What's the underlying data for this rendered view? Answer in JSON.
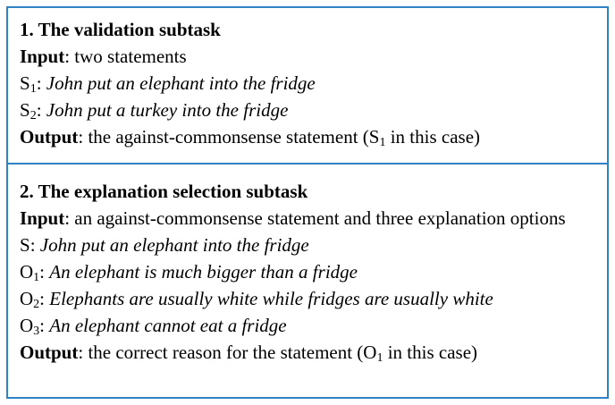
{
  "colors": {
    "border": "#2f83c5",
    "text": "#000000",
    "background": "#ffffff"
  },
  "validation": {
    "title": "1. The validation subtask",
    "input_label": "Input",
    "input_text": ": two statements",
    "s1_letter": "S",
    "s1_sub": "1",
    "s1_text": "John put an elephant into the fridge",
    "s2_letter": "S",
    "s2_sub": "2",
    "s2_text": "John put a turkey into the fridge",
    "output_label": "Output",
    "output_text_before": ": the against-commonsense statement (S",
    "output_sub": "1",
    "output_text_after": " in this case)"
  },
  "explanation": {
    "title": "2. The explanation selection subtask",
    "input_label": "Input",
    "input_text": ": an against-commonsense statement and three explanation options",
    "s_letter": "S",
    "s_text": "John put an elephant into the fridge",
    "options": [
      {
        "letter": "O",
        "sub": "1",
        "text": "An elephant is much bigger than a fridge"
      },
      {
        "letter": "O",
        "sub": "2",
        "text": "Elephants are usually white while fridges are usually white"
      },
      {
        "letter": "O",
        "sub": "3",
        "text": "An elephant cannot eat a fridge"
      }
    ],
    "output_label": "Output",
    "output_text_before": ": the correct reason for the statement (O",
    "output_sub": "1",
    "output_text_after": " in this case)"
  }
}
